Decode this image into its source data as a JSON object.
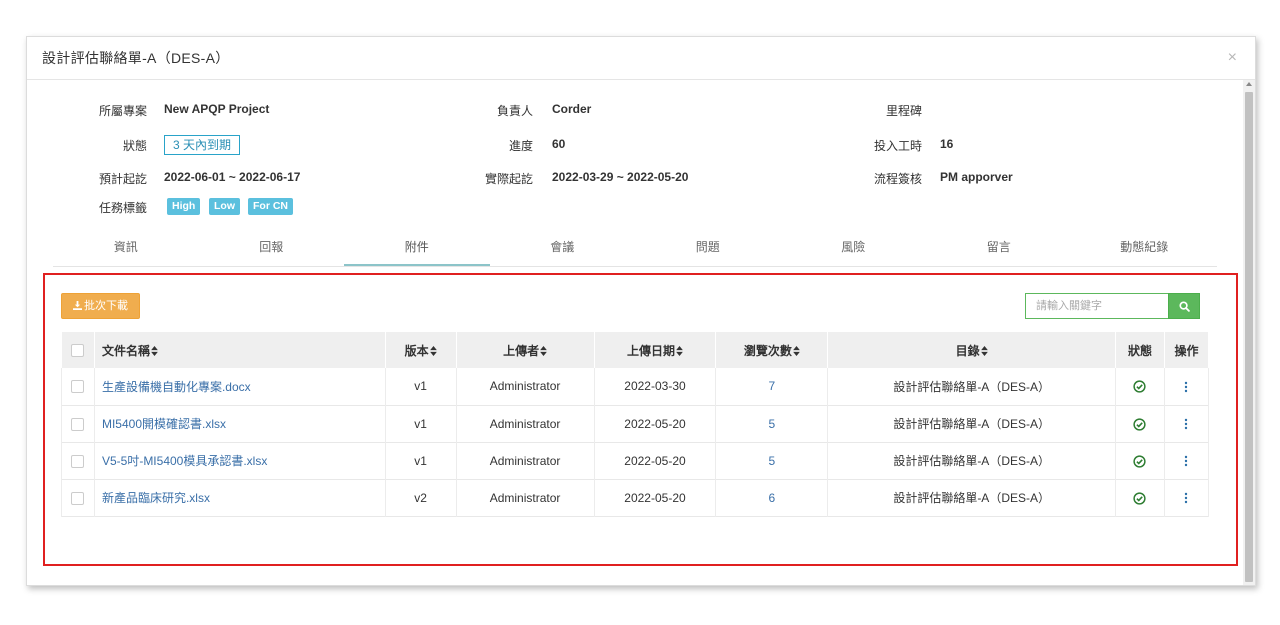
{
  "modal": {
    "title": "設計評估聯絡單-A（DES-A）",
    "close_label": "×"
  },
  "info": {
    "project_label": "所屬專案",
    "project_value": "New APQP Project",
    "owner_label": "負責人",
    "owner_value": "Corder",
    "milestone_label": "里程碑",
    "milestone_value": "",
    "status_label": "狀態",
    "status_value": "3 天內到期",
    "progress_label": "進度",
    "progress_value": "60",
    "hours_label": "投入工時",
    "hours_value": "16",
    "planned_label": "預計起訖",
    "planned_value": "2022-06-01 ~ 2022-06-17",
    "actual_label": "實際起訖",
    "actual_value": "2022-03-29 ~ 2022-05-20",
    "flow_label": "流程簽核",
    "flow_value": "PM apporver",
    "tags_label": "任務標籤",
    "tags": [
      "High",
      "Low",
      "For CN"
    ],
    "tag_color": "#5bc0de"
  },
  "tabs": [
    {
      "label": "資訊",
      "active": false
    },
    {
      "label": "回報",
      "active": false
    },
    {
      "label": "附件",
      "active": true
    },
    {
      "label": "會議",
      "active": false
    },
    {
      "label": "問題",
      "active": false
    },
    {
      "label": "風險",
      "active": false
    },
    {
      "label": "留言",
      "active": false
    },
    {
      "label": "動態紀錄",
      "active": false
    }
  ],
  "toolbar": {
    "batch_download_label": "批次下載",
    "search_placeholder": "請輸入關鍵字",
    "batch_color": "#f0ad4e",
    "search_color": "#5cb85c"
  },
  "table": {
    "headers": {
      "name": "文件名稱",
      "version": "版本",
      "uploader": "上傳者",
      "date": "上傳日期",
      "views": "瀏覽次數",
      "folder": "目錄",
      "status": "狀態",
      "action": "操作"
    },
    "rows": [
      {
        "name": "生產設備機自動化專案.docx",
        "version": "v1",
        "uploader": "Administrator",
        "date": "2022-03-30",
        "views": "7",
        "folder": "設計評估聯絡單-A（DES-A）"
      },
      {
        "name": "MI5400開模確認書.xlsx",
        "version": "v1",
        "uploader": "Administrator",
        "date": "2022-05-20",
        "views": "5",
        "folder": "設計評估聯絡單-A（DES-A）"
      },
      {
        "name": "V5-5吋-MI5400模具承認書.xlsx",
        "version": "v1",
        "uploader": "Administrator",
        "date": "2022-05-20",
        "views": "5",
        "folder": "設計評估聯絡單-A（DES-A）"
      },
      {
        "name": "新產品臨床研究.xlsx",
        "version": "v2",
        "uploader": "Administrator",
        "date": "2022-05-20",
        "views": "6",
        "folder": "設計評估聯絡單-A（DES-A）"
      }
    ]
  }
}
